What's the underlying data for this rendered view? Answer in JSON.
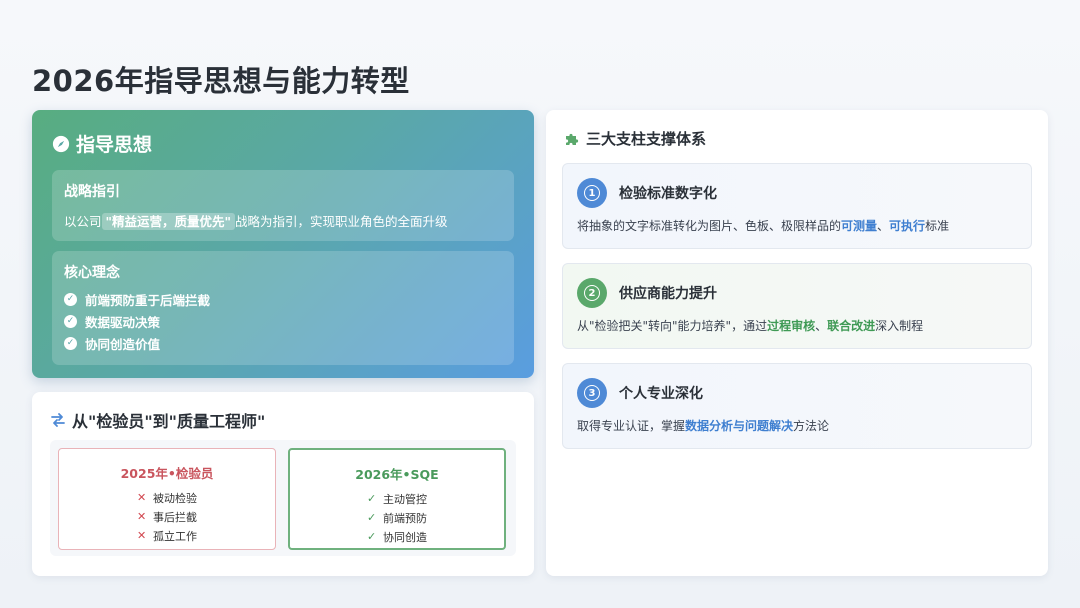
{
  "page": {
    "title": "2026年指导思想与能力转型"
  },
  "guide": {
    "title": "指导思想",
    "strategy": {
      "title": "战略指引",
      "text_prefix": "以公司",
      "highlight": "\"精益运营，质量优先\"",
      "text_suffix": "战略为指引，实现职业角色的全面升级"
    },
    "concept": {
      "title": "核心理念",
      "items": [
        "前端预防重于后端拦截",
        "数据驱动决策",
        "协同创造价值"
      ]
    }
  },
  "transition": {
    "title": "从\"检验员\"到\"质量工程师\"",
    "old": {
      "title": "2025年•检验员",
      "items": [
        "被动检验",
        "事后拦截",
        "孤立工作"
      ]
    },
    "new": {
      "title": "2026年•SQE",
      "items": [
        "主动管控",
        "前端预防",
        "协同创造"
      ]
    }
  },
  "pillars": {
    "title": "三大支柱支撑体系",
    "items": [
      {
        "num": "1",
        "title": "检验标准数字化",
        "desc_a": "将抽象的文字标准转化为图片、色板、极限样品的",
        "hl_1": "可测量",
        "sep": "、",
        "hl_2": "可执行",
        "desc_b": "标准"
      },
      {
        "num": "2",
        "title": "供应商能力提升",
        "desc_a": "从\"检验把关\"转向\"能力培养\"，通过",
        "hl_1": "过程审核",
        "sep": "、",
        "hl_2": "联合改进",
        "desc_b": "深入制程"
      },
      {
        "num": "3",
        "title": "个人专业深化",
        "desc_a": "取得专业认证，掌握",
        "hl_1": "数据分析与问题解决",
        "desc_b": "方法论"
      }
    ]
  },
  "colors": {
    "accent_blue": "#4f8ad6",
    "accent_green": "#5aa86b",
    "danger_red": "#d1474f"
  },
  "icons": {
    "guide": "compass-icon",
    "transition": "swap-arrows-icon",
    "pillars": "puzzle-icon",
    "check": "check-circle-icon",
    "cross": "cross-icon",
    "tick": "tick-icon"
  }
}
